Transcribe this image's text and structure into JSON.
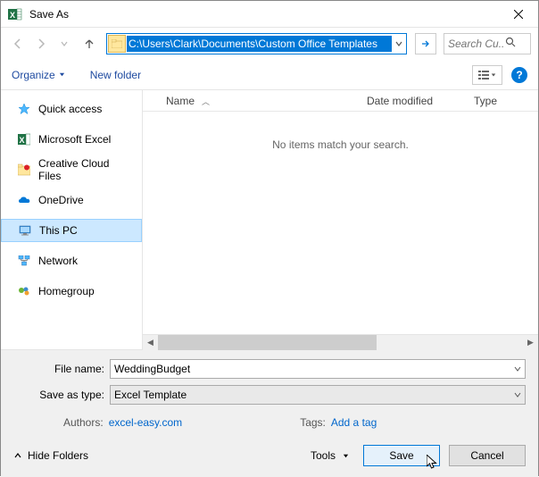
{
  "window": {
    "title": "Save As"
  },
  "nav": {
    "path": "C:\\Users\\Clark\\Documents\\Custom Office Templates",
    "search_placeholder": "Search Cu..."
  },
  "toolbar": {
    "organize": "Organize",
    "new_folder": "New folder"
  },
  "sidebar": {
    "items": [
      {
        "label": "Quick access"
      },
      {
        "label": "Microsoft Excel"
      },
      {
        "label": "Creative Cloud Files"
      },
      {
        "label": "OneDrive"
      },
      {
        "label": "This PC"
      },
      {
        "label": "Network"
      },
      {
        "label": "Homegroup"
      }
    ]
  },
  "columns": {
    "name": "Name",
    "date": "Date modified",
    "type": "Type"
  },
  "empty_message": "No items match your search.",
  "fields": {
    "filename_label": "File name:",
    "filename_value": "WeddingBudget",
    "savetype_label": "Save as type:",
    "savetype_value": "Excel Template",
    "authors_label": "Authors:",
    "authors_value": "excel-easy.com",
    "tags_label": "Tags:",
    "tags_value": "Add a tag"
  },
  "buttons": {
    "hide_folders": "Hide Folders",
    "tools": "Tools",
    "save": "Save",
    "cancel": "Cancel"
  }
}
